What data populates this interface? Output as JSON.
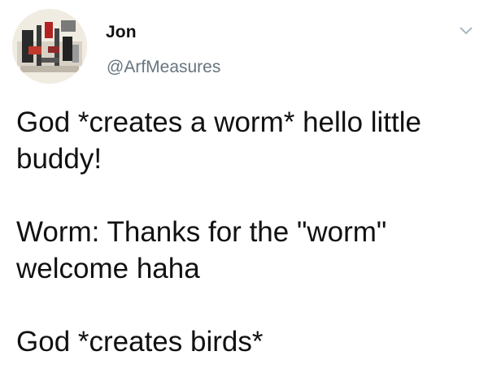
{
  "tweet": {
    "author": {
      "display_name": "Jon",
      "handle": "@ArfMeasures",
      "avatar_icon": "avatar-photo"
    },
    "menu_icon": "chevron-down-icon",
    "text_paragraphs": [
      "God *creates a worm* hello little buddy!",
      "Worm: Thanks for the \"worm\" welcome haha",
      "God *creates birds*"
    ]
  },
  "colors": {
    "text": "#111111",
    "handle": "#66757f",
    "chevron": "#aab8c2",
    "background": "#ffffff"
  }
}
